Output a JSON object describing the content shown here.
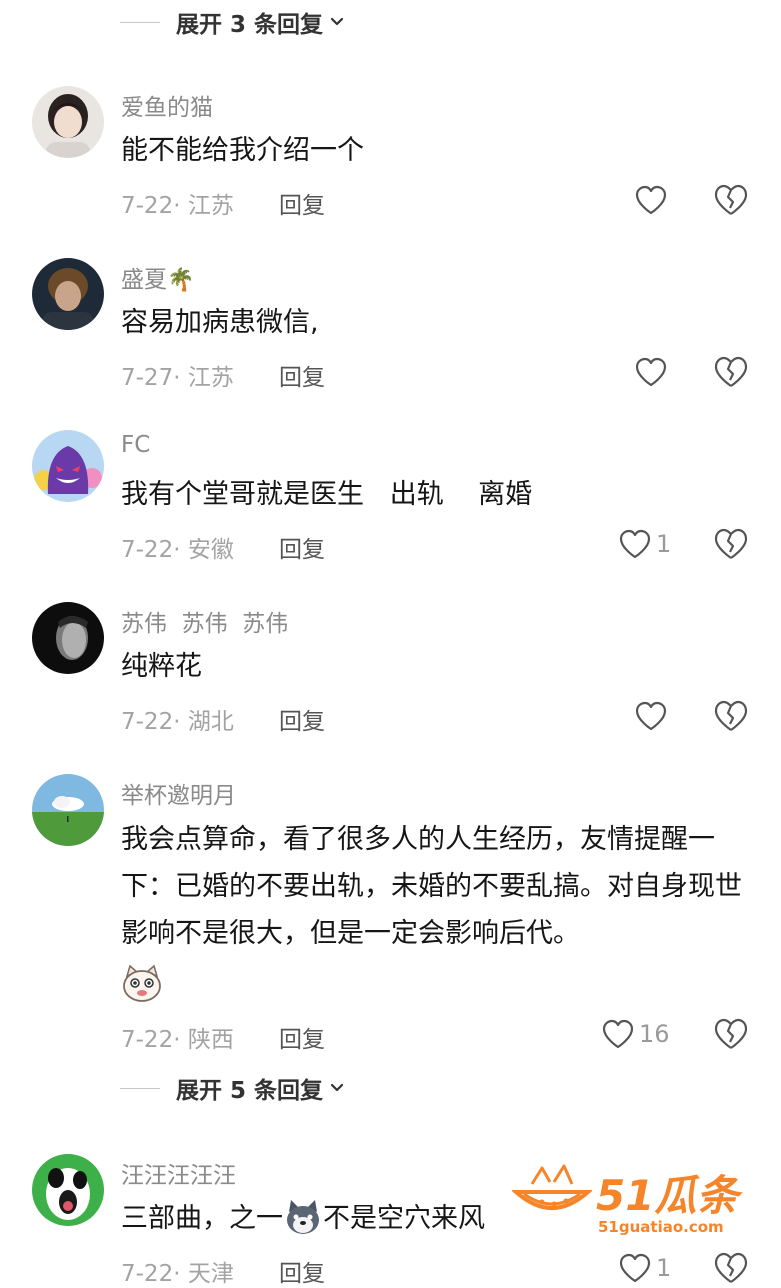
{
  "expand_top": {
    "label": "展开 3 条回复"
  },
  "expand_mid": {
    "label": "展开 5 条回复"
  },
  "comments": [
    {
      "user": "爱鱼的猫",
      "text": "能不能给我介绍一个",
      "date": "7-22",
      "region": "江苏",
      "reply": "回复",
      "likes": ""
    },
    {
      "user": "盛夏",
      "user_emoji": "🌴",
      "text": "容易加病患微信,",
      "date": "7-27",
      "region": "江苏",
      "reply": "回复",
      "likes": ""
    },
    {
      "user": "FC",
      "text": "我有个堂哥就是医生   出轨    离婚",
      "date": "7-22",
      "region": "安徽",
      "reply": "回复",
      "likes": "1"
    },
    {
      "user": "苏伟  苏伟  苏伟",
      "text": "纯粹花",
      "date": "7-22",
      "region": "湖北",
      "reply": "回复",
      "likes": ""
    },
    {
      "user": "举杯邀明月",
      "text": "我会点算命，看了很多人的人生经历，友情提醒一下：已婚的不要出轨，未婚的不要乱搞。对自身现世影响不是很大，但是一定会影响后代。",
      "date": "7-22",
      "region": "陕西",
      "reply": "回复",
      "likes": "16"
    },
    {
      "user": "汪汪汪汪汪",
      "text_a": "三部曲，之一",
      "text_b": "不是空穴来风",
      "date": "7-22",
      "region": "天津",
      "reply": "回复",
      "likes": "1"
    }
  ],
  "watermark": {
    "brand": "51瓜条",
    "url": "51guatiao.com"
  },
  "colors": {
    "text": "#161616",
    "meta": "#a3a3a3",
    "username": "#8a8a8a",
    "icon": "#555555",
    "watermark": "#f5852a"
  }
}
